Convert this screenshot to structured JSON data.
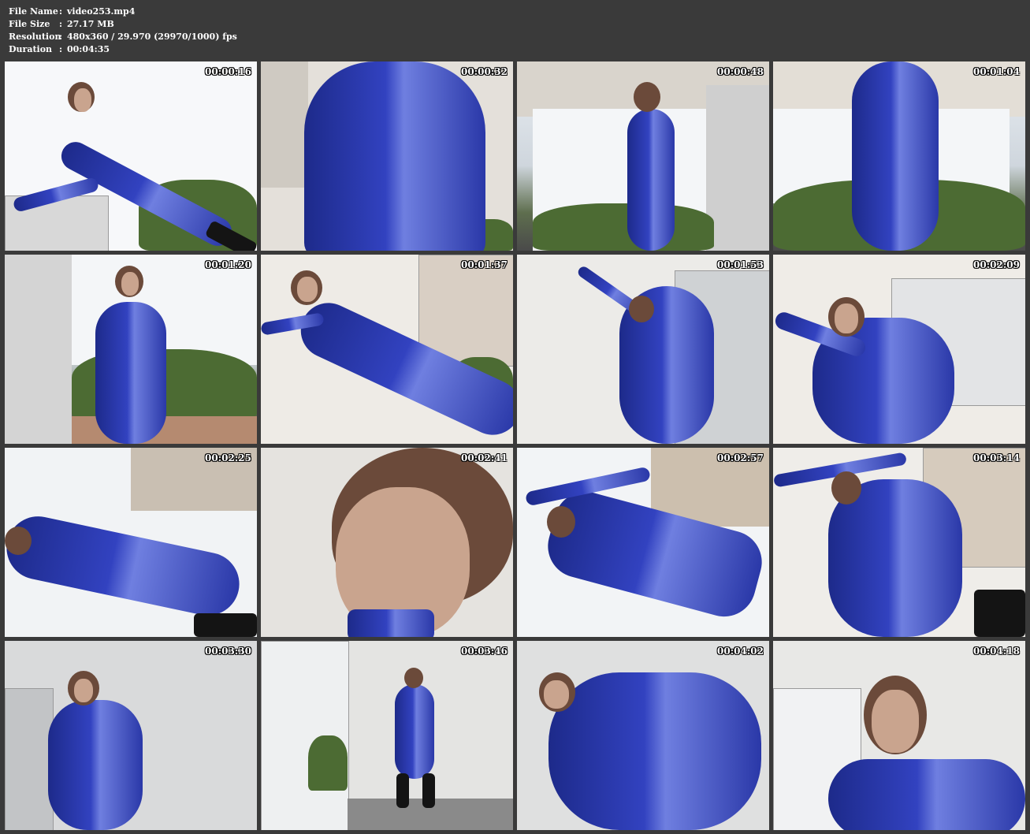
{
  "header": {
    "file_name_label": "File Name",
    "file_name_value": "video253.mp4",
    "file_size_label": "File Size",
    "file_size_value": "27.17 MB",
    "resolution_label": "Resolution",
    "resolution_value": "480x360 / 29.970 (29970/1000) fps",
    "duration_label": "Duration",
    "duration_value": "00:04:35",
    "separator": ":"
  },
  "thumbnails": [
    {
      "timestamp": "00:00:16"
    },
    {
      "timestamp": "00:00:32"
    },
    {
      "timestamp": "00:00:48"
    },
    {
      "timestamp": "00:01:04"
    },
    {
      "timestamp": "00:01:20"
    },
    {
      "timestamp": "00:01:37"
    },
    {
      "timestamp": "00:01:53"
    },
    {
      "timestamp": "00:02:09"
    },
    {
      "timestamp": "00:02:25"
    },
    {
      "timestamp": "00:02:41"
    },
    {
      "timestamp": "00:02:57"
    },
    {
      "timestamp": "00:03:14"
    },
    {
      "timestamp": "00:03:30"
    },
    {
      "timestamp": "00:03:46"
    },
    {
      "timestamp": "00:04:02"
    },
    {
      "timestamp": "00:04:18"
    }
  ]
}
